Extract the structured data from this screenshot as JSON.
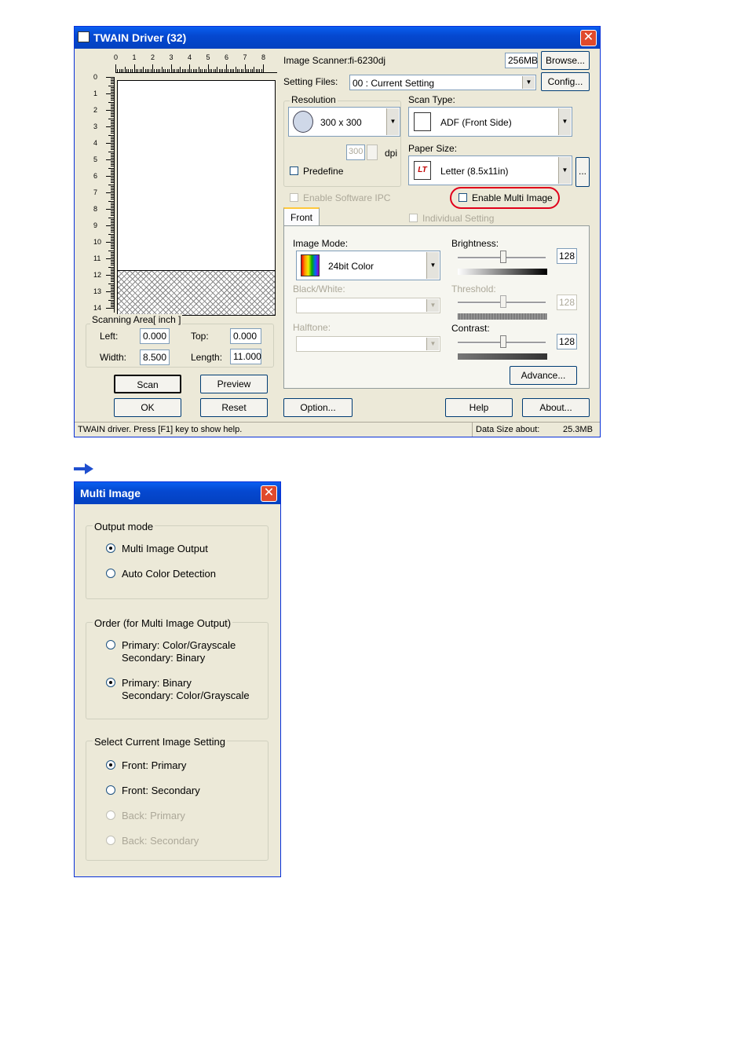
{
  "twain": {
    "title": "TWAIN Driver (32)",
    "ruler_h_ticks": [
      "0",
      "1",
      "2",
      "3",
      "4",
      "5",
      "6",
      "7",
      "8"
    ],
    "ruler_v_ticks": [
      "0",
      "1",
      "2",
      "3",
      "4",
      "5",
      "6",
      "7",
      "8",
      "9",
      "10",
      "11",
      "12",
      "13",
      "14"
    ],
    "scanning_area": {
      "label": "Scanning Area[ inch ]",
      "left_label": "Left:",
      "left_value": "0.000",
      "top_label": "Top:",
      "top_value": "0.000",
      "width_label": "Width:",
      "width_value": "8.500",
      "length_label": "Length:",
      "length_value": "11.000"
    },
    "buttons": {
      "scan": "Scan",
      "preview": "Preview",
      "ok": "OK",
      "reset": "Reset",
      "option": "Option...",
      "help": "Help",
      "about": "About...",
      "browse": "Browse...",
      "config": "Config...",
      "advance": "Advance...",
      "more": "..."
    },
    "image_scanner_label": "Image Scanner:",
    "image_scanner_value": "fi-6230dj",
    "memory": "256MB",
    "setting_files_label": "Setting Files:",
    "setting_files_value": "00 : Current Setting",
    "resolution_label": "Resolution",
    "resolution_value": "300 x 300",
    "dpi_value": "300",
    "dpi_label": "dpi",
    "predefine_label": "Predefine",
    "scan_type_label": "Scan Type:",
    "scan_type_value": "ADF (Front Side)",
    "paper_size_label": "Paper Size:",
    "paper_size_value": "Letter (8.5x11in)",
    "paper_icon_text": "LT",
    "enable_software_ipc": "Enable Software IPC",
    "enable_multi_image": "Enable Multi Image",
    "front_tab": "Front",
    "individual_setting": "Individual Setting",
    "image_mode_label": "Image Mode:",
    "image_mode_value": "24bit Color",
    "black_white_label": "Black/White:",
    "halftone_label": "Halftone:",
    "brightness_label": "Brightness:",
    "brightness_value": "128",
    "threshold_label": "Threshold:",
    "threshold_value": "128",
    "contrast_label": "Contrast:",
    "contrast_value": "128",
    "status_text": "TWAIN driver. Press [F1] key to show help.",
    "data_size_label": "Data Size about:",
    "data_size_value": "25.3MB",
    "highlight_color": "#e0001b"
  },
  "multi": {
    "title": "Multi Image",
    "output_mode": {
      "label": "Output mode",
      "options": [
        "Multi Image Output",
        "Auto Color Detection"
      ],
      "selected": 0
    },
    "order": {
      "label": "Order (for Multi Image Output)",
      "opt1_line1": "Primary: Color/Grayscale",
      "opt1_line2": "Secondary: Binary",
      "opt2_line1": "Primary: Binary",
      "opt2_line2": "Secondary: Color/Grayscale",
      "selected": 1
    },
    "select_current": {
      "label": "Select Current Image Setting",
      "options": [
        "Front: Primary",
        "Front: Secondary",
        "Back: Primary",
        "Back: Secondary"
      ],
      "selected": 0
    }
  }
}
